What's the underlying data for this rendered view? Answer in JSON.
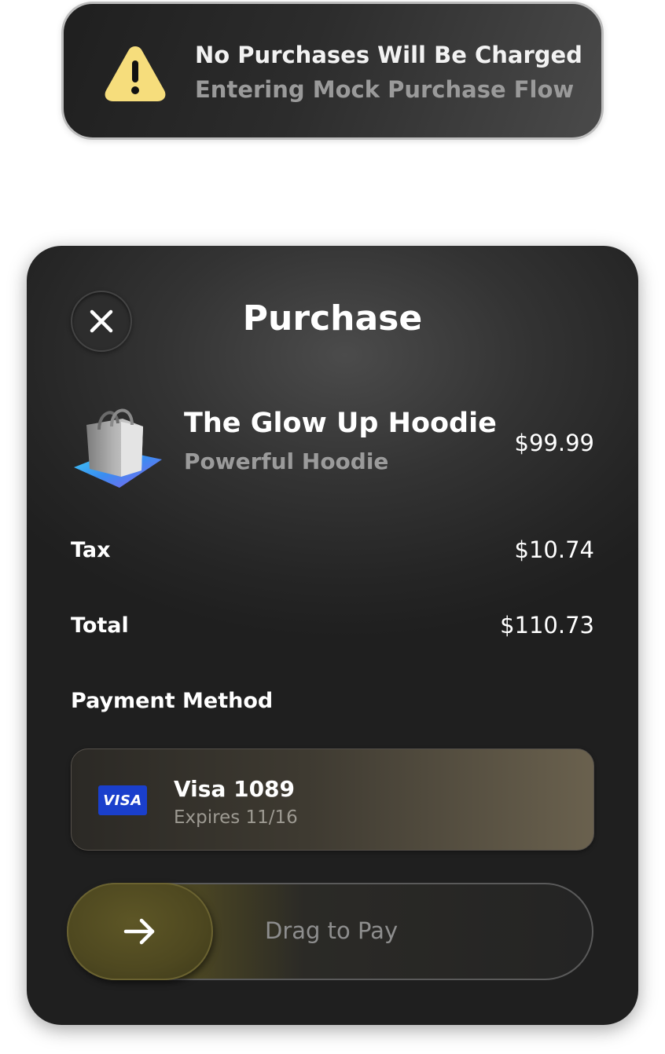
{
  "banner": {
    "icon": "warning-icon",
    "title": "No Purchases Will Be Charged",
    "subtitle": "Entering Mock Purchase Flow",
    "icon_color": "#f6dd7c"
  },
  "sheet": {
    "close_icon": "close-icon",
    "title": "Purchase",
    "product": {
      "icon": "shopping-bag-icon",
      "name": "The Glow Up Hoodie",
      "subtitle": "Powerful Hoodie",
      "price": "$99.99"
    },
    "tax": {
      "label": "Tax",
      "value": "$10.74"
    },
    "total": {
      "label": "Total",
      "value": "$110.73"
    },
    "payment_method_label": "Payment Method",
    "card": {
      "brand": "VISA",
      "name": "Visa 1089",
      "expires": "Expires 11/16",
      "brand_color": "#1a3fcc"
    },
    "slider": {
      "label": "Drag to Pay",
      "icon": "arrow-right-icon",
      "accent_color": "#5d5626"
    }
  }
}
